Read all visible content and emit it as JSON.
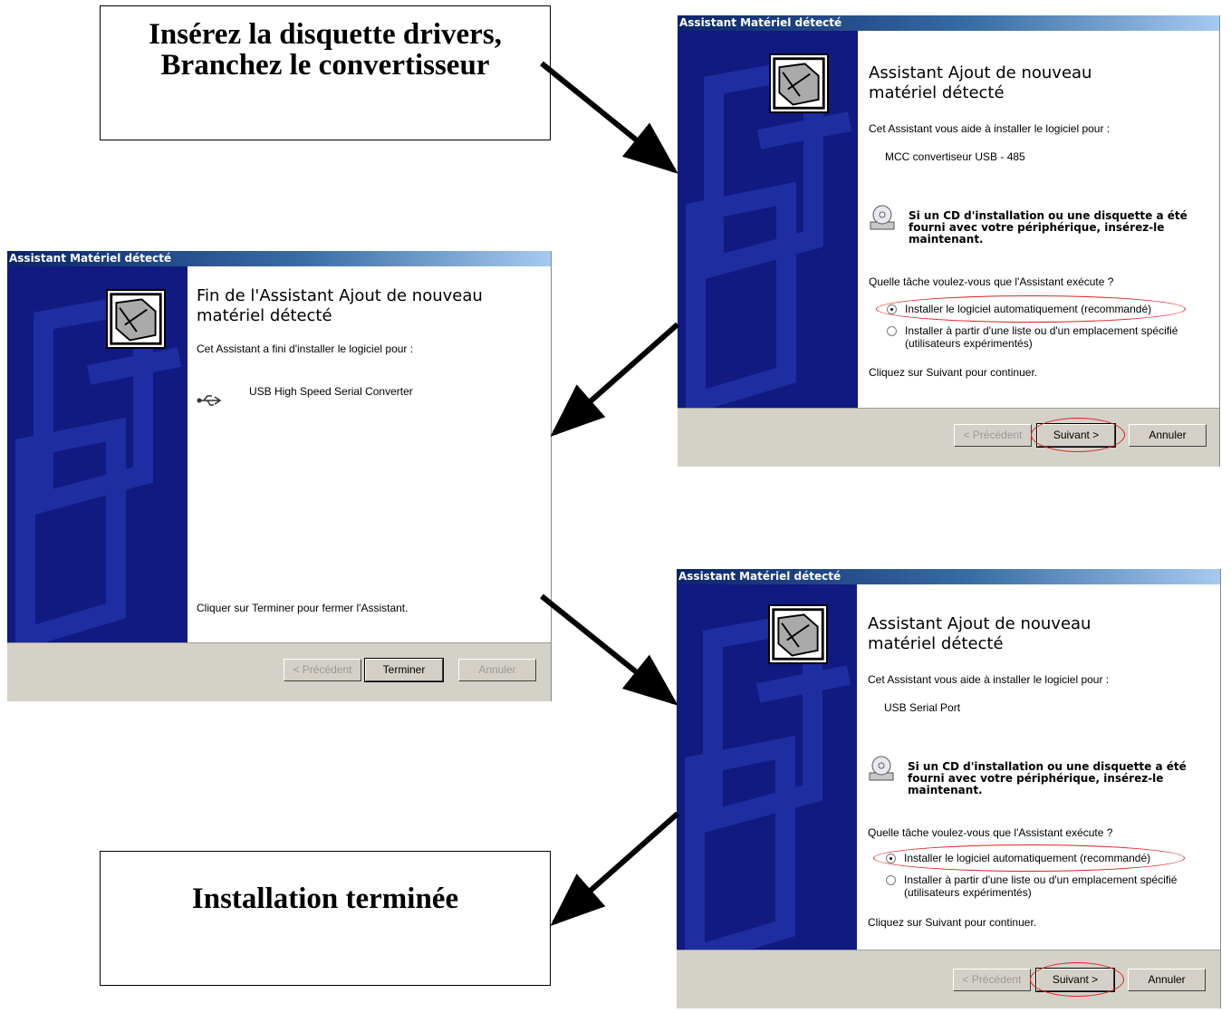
{
  "notes": {
    "top_line1": "Insérez la disquette drivers,",
    "top_line2": "Branchez le convertisseur",
    "bottom": "Installation terminée"
  },
  "dialog_right_top": {
    "title_bar": "Assistant Matériel détecté",
    "heading_line1": "Assistant Ajout de nouveau",
    "heading_line2": "matériel détecté",
    "intro": "Cet Assistant vous aide à installer le logiciel pour :",
    "device": "MCC convertiseur USB - 485",
    "cd_notice": "Si un CD d'installation ou une disquette a été fourni avec votre périphérique, insérez-le maintenant.",
    "question": "Quelle tâche voulez-vous que l'Assistant exécute ?",
    "option_auto": "Installer le logiciel automatiquement (recommandé)",
    "option_manual_1": "Installer à partir d'une liste ou d'un emplacement spécifié",
    "option_manual_2": "(utilisateurs expérimentés)",
    "continue_hint": "Cliquez sur Suivant pour continuer.",
    "btn_prev": "< Précédent",
    "btn_next": "Suivant >",
    "btn_cancel": "Annuler"
  },
  "dialog_left": {
    "title_bar": "Assistant Matériel détecté",
    "heading_line1": "Fin de l'Assistant Ajout de nouveau",
    "heading_line2": "matériel détecté",
    "intro": "Cet Assistant a fini d'installer le logiciel pour :",
    "device": "USB High Speed Serial Converter",
    "finish_hint": "Cliquer sur Terminer pour fermer l'Assistant.",
    "btn_prev": "< Précédent",
    "btn_finish": "Terminer",
    "btn_cancel": "Annuler"
  },
  "dialog_right_bottom": {
    "title_bar": "Assistant Matériel détecté",
    "heading_line1": "Assistant Ajout de nouveau",
    "heading_line2": "matériel détecté",
    "intro": "Cet Assistant vous aide à installer le logiciel pour :",
    "device": "USB Serial Port",
    "cd_notice": "Si un CD d'installation ou une disquette a été fourni avec votre périphérique, insérez-le maintenant.",
    "question": "Quelle tâche voulez-vous que l'Assistant exécute ?",
    "option_auto": "Installer le logiciel automatiquement (recommandé)",
    "option_manual_1": "Installer à partir d'une liste ou d'un emplacement spécifié",
    "option_manual_2": "(utilisateurs expérimentés)",
    "continue_hint": "Cliquez sur Suivant pour continuer.",
    "btn_prev": "< Précédent",
    "btn_next": "Suivant >",
    "btn_cancel": "Annuler"
  },
  "colors": {
    "side_panel": "#101a80",
    "title_gradient_start": "#0a246a",
    "highlight_ring": "#e02020"
  },
  "icons": [
    "hardware-wizard-icon",
    "cd-drive-icon",
    "usb-icon",
    "arrow-icon"
  ]
}
